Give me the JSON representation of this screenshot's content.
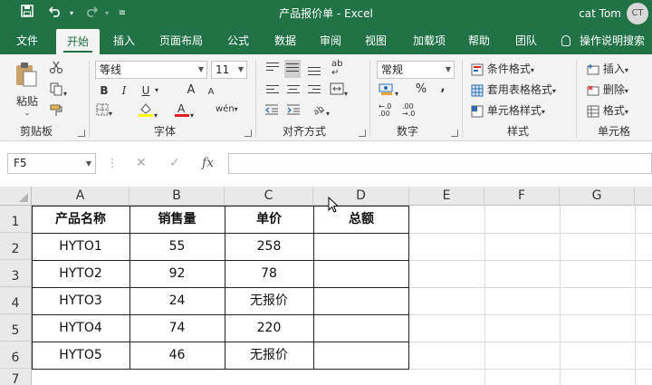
{
  "app": {
    "title": "产品报价单  -  Excel",
    "user": "cat Tom",
    "avatar_initials": "CT",
    "accent": "#217346"
  },
  "quick_access": {
    "save_icon": "save-icon",
    "undo_icon": "undo-icon",
    "redo_icon": "redo-icon",
    "customize_icon": "customize-qat-icon"
  },
  "tabs": [
    "文件",
    "开始",
    "插入",
    "页面布局",
    "公式",
    "数据",
    "审阅",
    "视图",
    "加载项",
    "帮助",
    "团队"
  ],
  "active_tab": "开始",
  "tell_me": "操作说明搜索",
  "ribbon": {
    "clipboard": {
      "label": "剪贴板",
      "paste": "粘贴"
    },
    "font": {
      "label": "字体",
      "font_name": "等线",
      "font_size": "11",
      "bold": "B",
      "italic": "I",
      "underline": "U",
      "grow": "A",
      "shrink": "A",
      "phonetic": "wén"
    },
    "alignment": {
      "label": "对齐方式"
    },
    "number": {
      "label": "数字",
      "format": "常规",
      "percent": "%",
      "comma": ",",
      "inc_decimal": ".00",
      "dec_decimal": ".00"
    },
    "styles": {
      "label": "样式",
      "conditional": "条件格式",
      "table": "套用表格格式",
      "cell_styles": "单元格样式"
    },
    "cells": {
      "label": "单元格",
      "insert": "插入",
      "delete": "删除",
      "format": "格式"
    }
  },
  "formula_bar": {
    "name_box": "F5",
    "fx": "fx",
    "cancel": "✕",
    "enter": "✓",
    "value": ""
  },
  "columns": [
    "A",
    "B",
    "C",
    "D",
    "E",
    "F",
    "G"
  ],
  "rows": [
    "1",
    "2",
    "3",
    "4",
    "5",
    "6",
    "7"
  ],
  "table": {
    "headers": [
      "产品名称",
      "销售量",
      "单价",
      "总额"
    ],
    "rows": [
      [
        "HYTO1",
        "55",
        "258",
        ""
      ],
      [
        "HYTO2",
        "92",
        "78",
        ""
      ],
      [
        "HYTO3",
        "24",
        "无报价",
        ""
      ],
      [
        "HYTO4",
        "74",
        "220",
        ""
      ],
      [
        "HYTO5",
        "46",
        "无报价",
        ""
      ]
    ]
  }
}
